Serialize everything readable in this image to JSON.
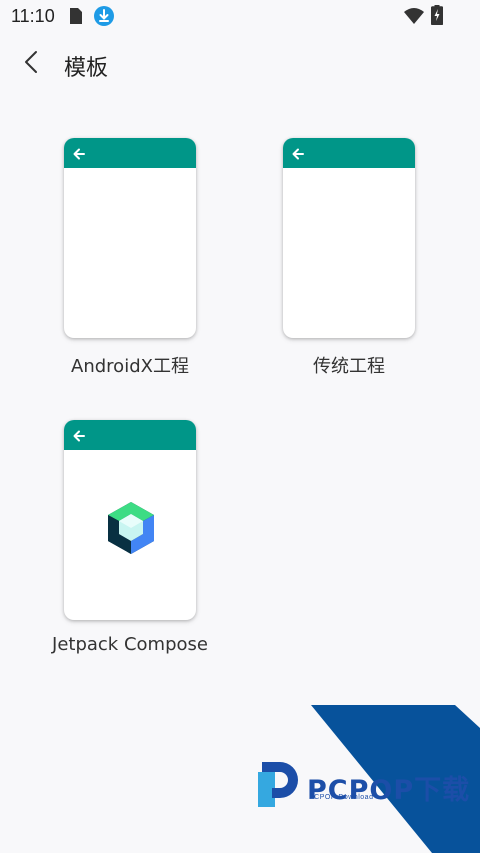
{
  "status_bar": {
    "time": "11:10",
    "icons": [
      "sim-card-icon",
      "download-icon",
      "wifi-icon",
      "battery-charging-icon"
    ]
  },
  "app_bar": {
    "title": "模板",
    "back_icon": "chevron-left-icon"
  },
  "templates": [
    {
      "label": "AndroidX工程",
      "icon": "back-arrow-icon",
      "header_color": "#009688"
    },
    {
      "label": "传统工程",
      "icon": "back-arrow-icon",
      "header_color": "#009688"
    },
    {
      "label": "Jetpack Compose",
      "icon": "back-arrow-icon",
      "header_color": "#009688",
      "logo": "jetpack-compose-logo"
    }
  ],
  "watermark": {
    "brand": "PCPOP下载",
    "subtitle": "PCPOP Download",
    "color": "#1c4ea8"
  },
  "colors": {
    "accent": "#009688",
    "background": "#f8f8fa",
    "download_badge": "#1e9be6"
  }
}
